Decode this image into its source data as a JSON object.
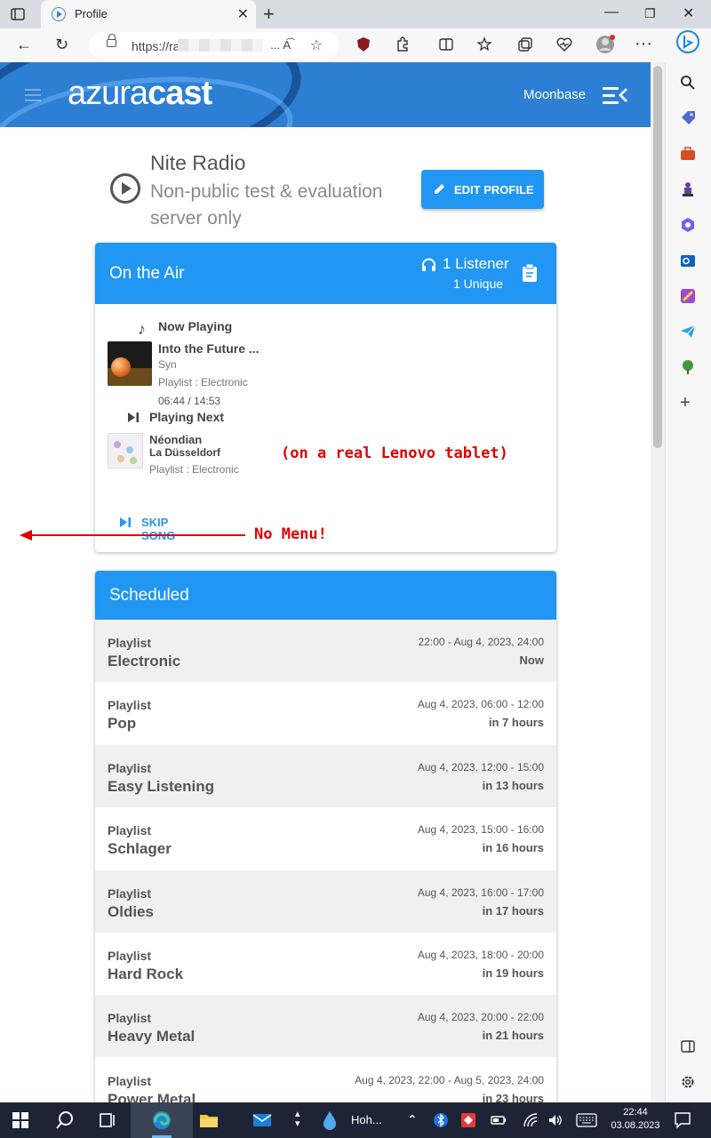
{
  "browser": {
    "tab_title": "Profile",
    "url_prefix": "https://ra",
    "url_suffix": "..."
  },
  "header": {
    "logo_regular": "azura",
    "logo_bold": "cast",
    "station_name": "Moonbase"
  },
  "profile": {
    "title": "Nite Radio",
    "description": "Non-public test & evaluation server only",
    "edit_label": "EDIT PROFILE"
  },
  "on_air": {
    "heading": "On the Air",
    "listeners": "1 Listener",
    "unique": "1  Unique",
    "now_playing_label": "Now Playing",
    "now": {
      "title": "Into the Future ...",
      "artist": "Syn",
      "playlist": "Playlist : Electronic",
      "time": "06:44 / 14:53"
    },
    "playing_next_label": "Playing Next",
    "next": {
      "title": "Néondian",
      "artist": "La Düsseldorf",
      "playlist": "Playlist : Electronic"
    },
    "skip_label": "SKIP SONG"
  },
  "annotations": {
    "tablet": "(on a real Lenovo tablet)",
    "menu": "No Menu!"
  },
  "scheduled": {
    "heading": "Scheduled",
    "rows": [
      {
        "type": "Playlist",
        "name": "Electronic",
        "time": "22:00 - Aug 4, 2023, 24:00",
        "rel": "Now"
      },
      {
        "type": "Playlist",
        "name": "Pop",
        "time": "Aug 4, 2023, 06:00 - 12:00",
        "rel": "in 7 hours"
      },
      {
        "type": "Playlist",
        "name": "Easy Listening",
        "time": "Aug 4, 2023, 12:00 - 15:00",
        "rel": "in 13 hours"
      },
      {
        "type": "Playlist",
        "name": "Schlager",
        "time": "Aug 4, 2023, 15:00 - 16:00",
        "rel": "in 16 hours"
      },
      {
        "type": "Playlist",
        "name": "Oldies",
        "time": "Aug 4, 2023, 16:00 - 17:00",
        "rel": "in 17 hours"
      },
      {
        "type": "Playlist",
        "name": "Hard Rock",
        "time": "Aug 4, 2023, 18:00 - 20:00",
        "rel": "in 19 hours"
      },
      {
        "type": "Playlist",
        "name": "Heavy Metal",
        "time": "Aug 4, 2023, 20:00 - 22:00",
        "rel": "in 21 hours"
      },
      {
        "type": "Playlist",
        "name": "Power Metal",
        "time": "Aug 4, 2023, 22:00 - Aug 5, 2023, 24:00",
        "rel": "in 23 hours"
      }
    ]
  },
  "taskbar": {
    "weather_text": "Hoh...",
    "time": "22:44",
    "date": "03.08.2023"
  },
  "colors": {
    "accent": "#2196f3",
    "header_bg": "#2d7fd3",
    "annotation": "#e00000",
    "row_shade": "#f0f0f0"
  }
}
